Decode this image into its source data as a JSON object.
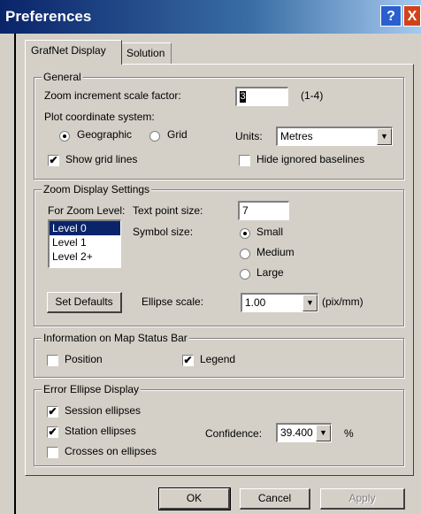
{
  "window": {
    "title": "Preferences",
    "help": "?",
    "close": "X"
  },
  "tabs": [
    {
      "label": "GrafNet Display",
      "active": true
    },
    {
      "label": "Solution",
      "active": false
    }
  ],
  "general": {
    "legend": "General",
    "zoom_label": "Zoom increment scale factor:",
    "zoom_value": "3",
    "zoom_range": "(1-4)",
    "plot_label": "Plot coordinate system:",
    "geo_label": "Geographic",
    "grid_label": "Grid",
    "units_label": "Units:",
    "units_value": "Metres",
    "show_grid_label": "Show grid lines",
    "show_grid_checked": true,
    "hide_baselines_label": "Hide ignored baselines",
    "hide_baselines_checked": false
  },
  "zoom_display": {
    "legend": "Zoom Display Settings",
    "level_label": "For Zoom Level:",
    "levels": [
      "Level 0",
      "Level 1",
      "Level 2+"
    ],
    "text_size_label": "Text point size:",
    "text_size_value": "7",
    "symbol_label": "Symbol size:",
    "symbol_small": "Small",
    "symbol_medium": "Medium",
    "symbol_large": "Large",
    "set_defaults": "Set Defaults",
    "ellipse_scale_label": "Ellipse scale:",
    "ellipse_scale_value": "1.00",
    "ellipse_scale_unit": "(pix/mm)"
  },
  "status_bar": {
    "legend": "Information on Map Status Bar",
    "position_label": "Position",
    "position_checked": false,
    "legend_label": "Legend",
    "legend_checked": true
  },
  "error_ellipse": {
    "legend": "Error Ellipse Display",
    "session_label": "Session ellipses",
    "session_checked": true,
    "station_label": "Station ellipses",
    "station_checked": true,
    "crosses_label": "Crosses on ellipses",
    "crosses_checked": false,
    "confidence_label": "Confidence:",
    "confidence_value": "39.400",
    "percent": "%"
  },
  "buttons": {
    "ok": "OK",
    "cancel": "Cancel",
    "apply": "Apply"
  },
  "icons": {
    "check": "✔",
    "dropdown": "▼"
  }
}
